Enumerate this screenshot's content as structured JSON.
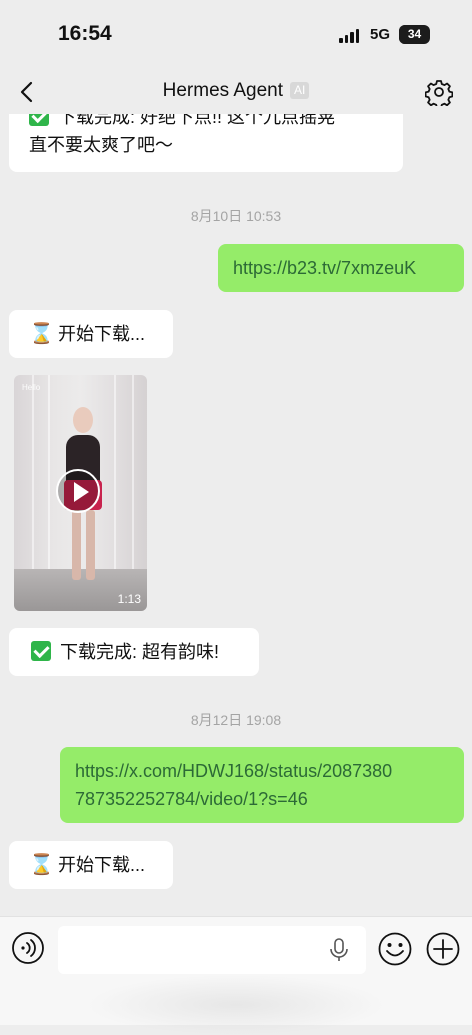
{
  "status_bar": {
    "time": "16:54",
    "network": "5G",
    "battery": "34",
    "battery_level": 0.34
  },
  "nav": {
    "title": "Hermes Agent",
    "badge": "AI"
  },
  "messages": {
    "m1_line1": "下载完成: 好绝下点!! 这个九点摇晃",
    "m1_line2": "直不要太爽了吧～",
    "t1": "8月10日 10:53",
    "m2": "https://b23.tv/7xmzeuK",
    "m3": "开始下载...",
    "video_duration": "1:13",
    "video_watermark": "Hello",
    "m4": "下载完成: 超有韵味!",
    "t2": "8月12日 19:08",
    "m5_line1": "https://x.com/HDWJ168/status/2087380",
    "m5_line2": "787352252784/video/1?s=46",
    "m6": "开始下载..."
  },
  "icons": {
    "back": "chevron-left-icon",
    "settings": "gear-icon",
    "voice": "voice-icon",
    "mic": "mic-icon",
    "emoji": "smile-icon",
    "plus": "plus-icon",
    "hourglass": "⌛",
    "check": "check-mark-icon"
  },
  "colors": {
    "outgoing_bubble": "#95ec69",
    "incoming_bubble": "#ffffff",
    "background": "#ededed",
    "check_green": "#2fb54a"
  }
}
